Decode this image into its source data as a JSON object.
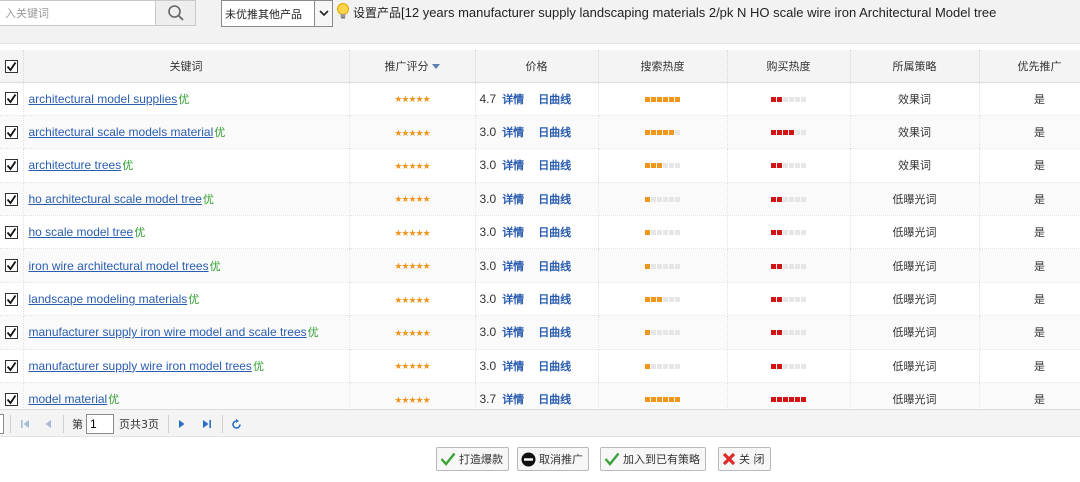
{
  "toolbar": {
    "search_placeholder": "入关键词",
    "product_filter": "未优推其他产品",
    "set_product_label": "设置产品",
    "set_product_value": "[12 years manufacturer supply landscaping materials 2/pk N HO scale wire iron Architectural Model tree"
  },
  "table": {
    "headers": {
      "keyword": "关键词",
      "rating": "推广评分",
      "price": "价格",
      "search_heat": "搜索热度",
      "buy_heat": "购买热度",
      "strategy": "所属策略",
      "priority": "优先推广"
    },
    "rows": [
      {
        "keyword": "architectural model supplies",
        "tag": "优",
        "stars": "★★★★★",
        "price": "4.7",
        "detail": "详情",
        "curve": "日曲线",
        "search_heat": 6,
        "buy_heat": 2,
        "strategy": "效果词",
        "priority": "是"
      },
      {
        "keyword": "architectural scale models material",
        "tag": "优",
        "stars": "★★★★★",
        "price": "3.0",
        "detail": "详情",
        "curve": "日曲线",
        "search_heat": 5,
        "buy_heat": 4,
        "strategy": "效果词",
        "priority": "是"
      },
      {
        "keyword": "architecture trees",
        "tag": "优",
        "stars": "★★★★★",
        "price": "3.0",
        "detail": "详情",
        "curve": "日曲线",
        "search_heat": 3,
        "buy_heat": 2,
        "strategy": "效果词",
        "priority": "是"
      },
      {
        "keyword": "ho architectural scale model tree",
        "tag": "优",
        "stars": "★★★★★",
        "price": "3.0",
        "detail": "详情",
        "curve": "日曲线",
        "search_heat": 1,
        "buy_heat": 2,
        "strategy": "低曝光词",
        "priority": "是"
      },
      {
        "keyword": "ho scale model tree",
        "tag": "优",
        "stars": "★★★★★",
        "price": "3.0",
        "detail": "详情",
        "curve": "日曲线",
        "search_heat": 1,
        "buy_heat": 2,
        "strategy": "低曝光词",
        "priority": "是"
      },
      {
        "keyword": "iron wire architectural model trees",
        "tag": "优",
        "stars": "★★★★★",
        "price": "3.0",
        "detail": "详情",
        "curve": "日曲线",
        "search_heat": 1,
        "buy_heat": 2,
        "strategy": "低曝光词",
        "priority": "是"
      },
      {
        "keyword": "landscape modeling materials",
        "tag": "优",
        "stars": "★★★★★",
        "price": "3.0",
        "detail": "详情",
        "curve": "日曲线",
        "search_heat": 3,
        "buy_heat": 2,
        "strategy": "低曝光词",
        "priority": "是"
      },
      {
        "keyword": "manufacturer supply iron wire model and scale trees",
        "tag": "优",
        "stars": "★★★★★",
        "price": "3.0",
        "detail": "详情",
        "curve": "日曲线",
        "search_heat": 1,
        "buy_heat": 2,
        "strategy": "低曝光词",
        "priority": "是"
      },
      {
        "keyword": "manufacturer supply wire iron model trees",
        "tag": "优",
        "stars": "★★★★★",
        "price": "3.0",
        "detail": "详情",
        "curve": "日曲线",
        "search_heat": 1,
        "buy_heat": 2,
        "strategy": "低曝光词",
        "priority": "是"
      },
      {
        "keyword": "model material",
        "tag": "优",
        "stars": "★★★★★",
        "price": "3.7",
        "detail": "详情",
        "curve": "日曲线",
        "search_heat": 6,
        "buy_heat": 6,
        "strategy": "低曝光词",
        "priority": "是"
      }
    ]
  },
  "pager": {
    "page_prefix": "第",
    "current_page": "1",
    "page_suffix": "页共3页"
  },
  "actions": {
    "create_hot": "打造爆款",
    "cancel_promo": "取消推广",
    "add_strategy": "加入到已有策略",
    "close": "关 闭"
  },
  "colors": {
    "link": "#2a5db0",
    "star": "#f0961e",
    "search_heat_on": "#f09618",
    "buy_heat_on": "#d41414",
    "tag_green": "#2e9e2e"
  }
}
